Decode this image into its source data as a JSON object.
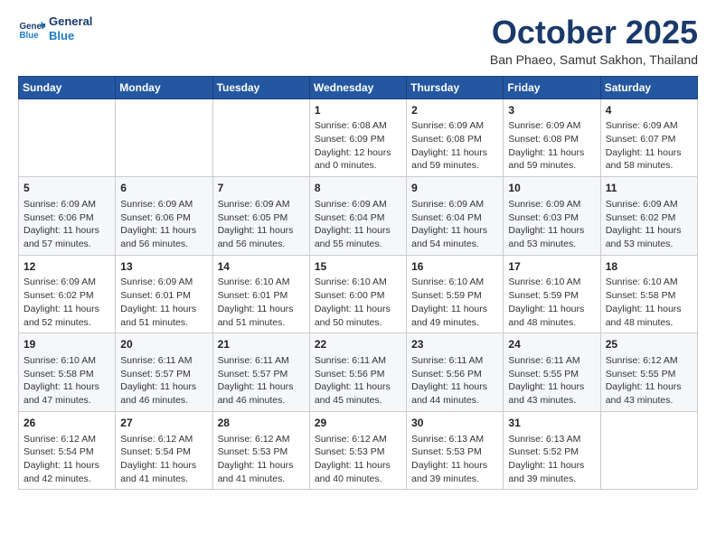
{
  "header": {
    "logo_general": "General",
    "logo_blue": "Blue",
    "month_title": "October 2025",
    "subtitle": "Ban Phaeo, Samut Sakhon, Thailand"
  },
  "days_of_week": [
    "Sunday",
    "Monday",
    "Tuesday",
    "Wednesday",
    "Thursday",
    "Friday",
    "Saturday"
  ],
  "weeks": [
    [
      {
        "day": "",
        "info": ""
      },
      {
        "day": "",
        "info": ""
      },
      {
        "day": "",
        "info": ""
      },
      {
        "day": "1",
        "info": "Sunrise: 6:08 AM\nSunset: 6:09 PM\nDaylight: 12 hours\nand 0 minutes."
      },
      {
        "day": "2",
        "info": "Sunrise: 6:09 AM\nSunset: 6:08 PM\nDaylight: 11 hours\nand 59 minutes."
      },
      {
        "day": "3",
        "info": "Sunrise: 6:09 AM\nSunset: 6:08 PM\nDaylight: 11 hours\nand 59 minutes."
      },
      {
        "day": "4",
        "info": "Sunrise: 6:09 AM\nSunset: 6:07 PM\nDaylight: 11 hours\nand 58 minutes."
      }
    ],
    [
      {
        "day": "5",
        "info": "Sunrise: 6:09 AM\nSunset: 6:06 PM\nDaylight: 11 hours\nand 57 minutes."
      },
      {
        "day": "6",
        "info": "Sunrise: 6:09 AM\nSunset: 6:06 PM\nDaylight: 11 hours\nand 56 minutes."
      },
      {
        "day": "7",
        "info": "Sunrise: 6:09 AM\nSunset: 6:05 PM\nDaylight: 11 hours\nand 56 minutes."
      },
      {
        "day": "8",
        "info": "Sunrise: 6:09 AM\nSunset: 6:04 PM\nDaylight: 11 hours\nand 55 minutes."
      },
      {
        "day": "9",
        "info": "Sunrise: 6:09 AM\nSunset: 6:04 PM\nDaylight: 11 hours\nand 54 minutes."
      },
      {
        "day": "10",
        "info": "Sunrise: 6:09 AM\nSunset: 6:03 PM\nDaylight: 11 hours\nand 53 minutes."
      },
      {
        "day": "11",
        "info": "Sunrise: 6:09 AM\nSunset: 6:02 PM\nDaylight: 11 hours\nand 53 minutes."
      }
    ],
    [
      {
        "day": "12",
        "info": "Sunrise: 6:09 AM\nSunset: 6:02 PM\nDaylight: 11 hours\nand 52 minutes."
      },
      {
        "day": "13",
        "info": "Sunrise: 6:09 AM\nSunset: 6:01 PM\nDaylight: 11 hours\nand 51 minutes."
      },
      {
        "day": "14",
        "info": "Sunrise: 6:10 AM\nSunset: 6:01 PM\nDaylight: 11 hours\nand 51 minutes."
      },
      {
        "day": "15",
        "info": "Sunrise: 6:10 AM\nSunset: 6:00 PM\nDaylight: 11 hours\nand 50 minutes."
      },
      {
        "day": "16",
        "info": "Sunrise: 6:10 AM\nSunset: 5:59 PM\nDaylight: 11 hours\nand 49 minutes."
      },
      {
        "day": "17",
        "info": "Sunrise: 6:10 AM\nSunset: 5:59 PM\nDaylight: 11 hours\nand 48 minutes."
      },
      {
        "day": "18",
        "info": "Sunrise: 6:10 AM\nSunset: 5:58 PM\nDaylight: 11 hours\nand 48 minutes."
      }
    ],
    [
      {
        "day": "19",
        "info": "Sunrise: 6:10 AM\nSunset: 5:58 PM\nDaylight: 11 hours\nand 47 minutes."
      },
      {
        "day": "20",
        "info": "Sunrise: 6:11 AM\nSunset: 5:57 PM\nDaylight: 11 hours\nand 46 minutes."
      },
      {
        "day": "21",
        "info": "Sunrise: 6:11 AM\nSunset: 5:57 PM\nDaylight: 11 hours\nand 46 minutes."
      },
      {
        "day": "22",
        "info": "Sunrise: 6:11 AM\nSunset: 5:56 PM\nDaylight: 11 hours\nand 45 minutes."
      },
      {
        "day": "23",
        "info": "Sunrise: 6:11 AM\nSunset: 5:56 PM\nDaylight: 11 hours\nand 44 minutes."
      },
      {
        "day": "24",
        "info": "Sunrise: 6:11 AM\nSunset: 5:55 PM\nDaylight: 11 hours\nand 43 minutes."
      },
      {
        "day": "25",
        "info": "Sunrise: 6:12 AM\nSunset: 5:55 PM\nDaylight: 11 hours\nand 43 minutes."
      }
    ],
    [
      {
        "day": "26",
        "info": "Sunrise: 6:12 AM\nSunset: 5:54 PM\nDaylight: 11 hours\nand 42 minutes."
      },
      {
        "day": "27",
        "info": "Sunrise: 6:12 AM\nSunset: 5:54 PM\nDaylight: 11 hours\nand 41 minutes."
      },
      {
        "day": "28",
        "info": "Sunrise: 6:12 AM\nSunset: 5:53 PM\nDaylight: 11 hours\nand 41 minutes."
      },
      {
        "day": "29",
        "info": "Sunrise: 6:12 AM\nSunset: 5:53 PM\nDaylight: 11 hours\nand 40 minutes."
      },
      {
        "day": "30",
        "info": "Sunrise: 6:13 AM\nSunset: 5:53 PM\nDaylight: 11 hours\nand 39 minutes."
      },
      {
        "day": "31",
        "info": "Sunrise: 6:13 AM\nSunset: 5:52 PM\nDaylight: 11 hours\nand 39 minutes."
      },
      {
        "day": "",
        "info": ""
      }
    ]
  ]
}
